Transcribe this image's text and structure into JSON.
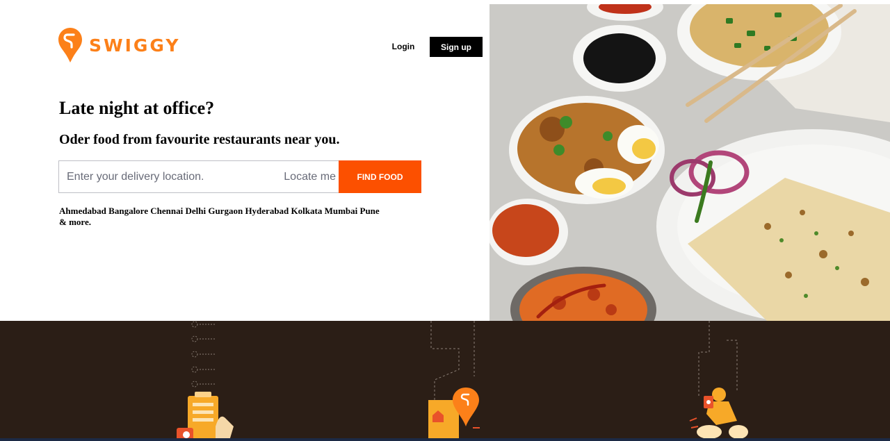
{
  "brand": {
    "name": "SWIGGY",
    "accent_color": "#fc8019",
    "logo_icon": "swiggy-pin-logo-icon"
  },
  "header": {
    "login_label": "Login",
    "signup_label": "Sign up"
  },
  "hero": {
    "headline": "Late night at office?",
    "subline": "Oder food from favourite restaurants near you."
  },
  "search": {
    "placeholder": "Enter your delivery location.",
    "value": "",
    "locate_label": "Locate me",
    "find_label": "FIND FOOD",
    "find_color": "#fc5000"
  },
  "cities": {
    "items": [
      "Ahmedabad",
      "Bangalore",
      "Chennai",
      "Delhi",
      "Gurgaon",
      "Hyderabad",
      "Kolkata",
      "Mumbai",
      "Pune"
    ],
    "suffix": "& more."
  },
  "food_image": {
    "description_icon": "food-platter-image"
  },
  "footer_illustrations": {
    "background_color": "#2b1e16",
    "icons": [
      "order-menu-icon",
      "location-pin-icon",
      "delivery-rider-icon"
    ]
  }
}
